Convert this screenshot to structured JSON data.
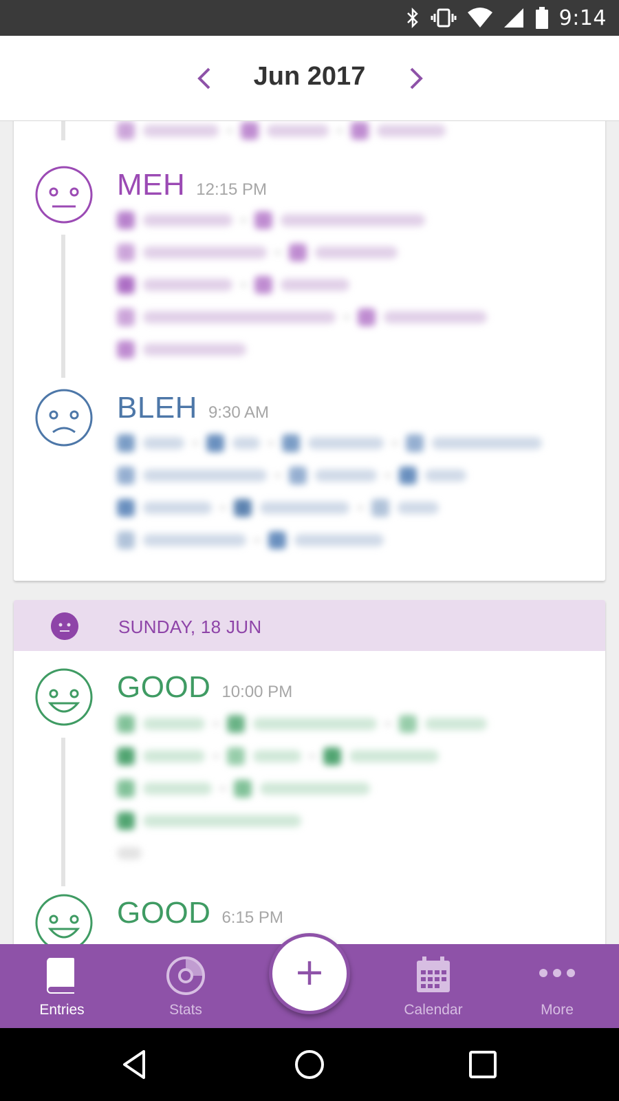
{
  "status_bar": {
    "time": "9:14"
  },
  "header": {
    "title": "Jun 2017"
  },
  "entries_day1": [
    {
      "mood": "MEH",
      "time": "12:15 PM",
      "color": "#9b4ab4",
      "face": "neutral-face"
    },
    {
      "mood": "BLEH",
      "time": "9:30 AM",
      "color": "#4d77a8",
      "face": "sad-face"
    }
  ],
  "day2": {
    "label": "SUNDAY, 18 JUN",
    "entries": [
      {
        "mood": "GOOD",
        "time": "10:00 PM",
        "color": "#3f9b63",
        "face": "smile-face"
      },
      {
        "mood": "GOOD",
        "time": "6:15 PM",
        "color": "#3f9b63",
        "face": "smile-face"
      }
    ]
  },
  "bottom_nav": {
    "tabs": [
      {
        "label": "Entries",
        "icon": "book-icon",
        "active": true
      },
      {
        "label": "Stats",
        "icon": "stats-disc-icon"
      },
      {
        "label": "Calendar",
        "icon": "calendar-icon"
      },
      {
        "label": "More",
        "icon": "more-dots-icon"
      }
    ],
    "fab_label": "+"
  },
  "colors": {
    "accent": "#8e52a8",
    "meh": "#9b4ab4",
    "bleh": "#4d77a8",
    "good": "#3f9b63",
    "day_header_bg": "#eadcee"
  }
}
